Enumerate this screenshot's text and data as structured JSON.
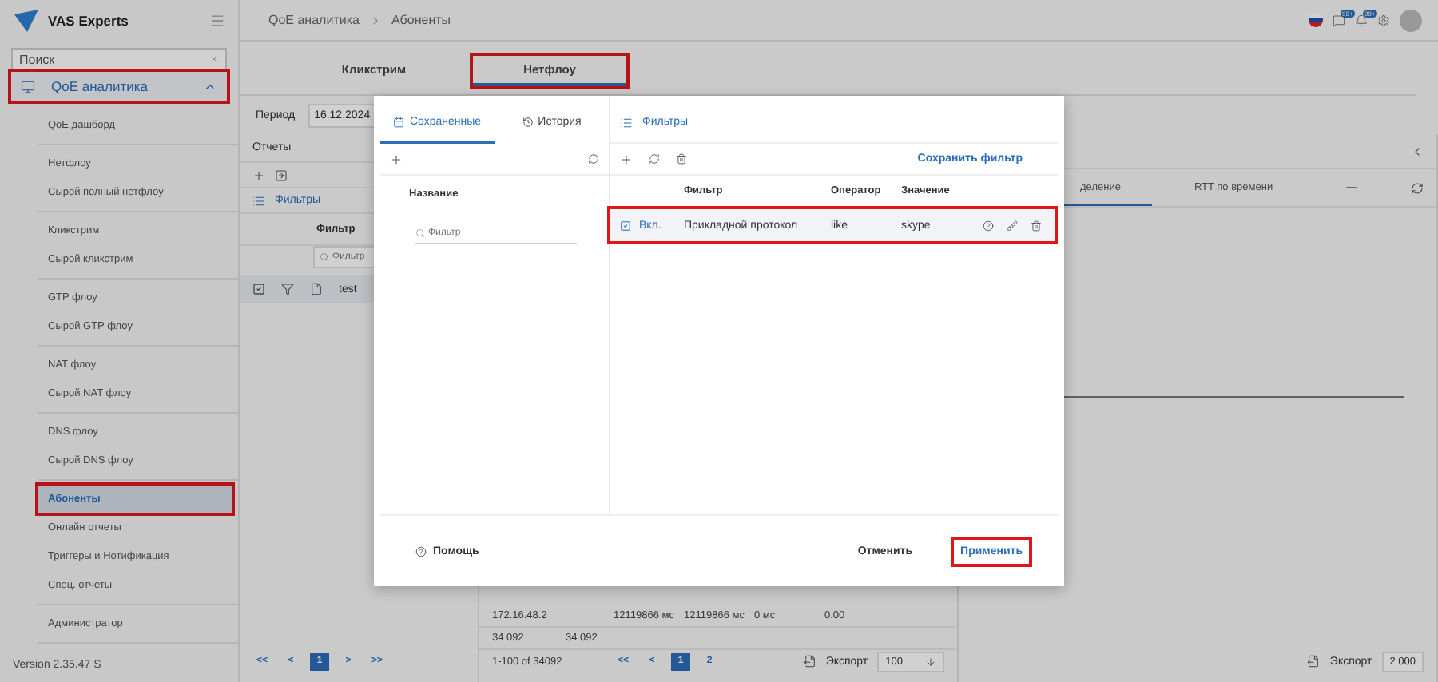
{
  "sidebar": {
    "logo_text": "VAS Experts",
    "search": {
      "placeholder": "Поиск"
    },
    "group": {
      "label": "QoE аналитика",
      "expanded": true,
      "highlighted": true
    },
    "sections": [
      {
        "items": [
          {
            "label": "QoE дашборд",
            "selected": false,
            "highlighted": false
          }
        ]
      },
      {
        "items": [
          {
            "label": "Нетфлоу",
            "selected": false,
            "highlighted": false
          },
          {
            "label": "Сырой полный нетфлоу",
            "selected": false,
            "highlighted": false
          }
        ]
      },
      {
        "items": [
          {
            "label": "Кликстрим",
            "selected": false,
            "highlighted": false
          },
          {
            "label": "Сырой кликстрим",
            "selected": false,
            "highlighted": false
          }
        ]
      },
      {
        "items": [
          {
            "label": "GTP флоу",
            "selected": false,
            "highlighted": false
          },
          {
            "label": "Сырой GTP флоу",
            "selected": false,
            "highlighted": false
          }
        ]
      },
      {
        "items": [
          {
            "label": "NAT флоу",
            "selected": false,
            "highlighted": false
          },
          {
            "label": "Сырой NAT флоу",
            "selected": false,
            "highlighted": false
          }
        ]
      },
      {
        "items": [
          {
            "label": "DNS флоу",
            "selected": false,
            "highlighted": false
          },
          {
            "label": "Сырой DNS флоу",
            "selected": false,
            "highlighted": false
          }
        ]
      },
      {
        "items": [
          {
            "label": "Абоненты",
            "selected": true,
            "highlighted": true
          },
          {
            "label": "Онлайн отчеты",
            "selected": false,
            "highlighted": false
          },
          {
            "label": "Триггеры и Нотификация",
            "selected": false,
            "highlighted": false
          },
          {
            "label": "Спец. отчеты",
            "selected": false,
            "highlighted": false
          }
        ]
      },
      {
        "items": [
          {
            "label": "Администратор",
            "selected": false,
            "highlighted": false
          }
        ]
      }
    ],
    "version": "Version 2.35.47 S"
  },
  "header": {
    "breadcrumb": [
      "QoE аналитика",
      "Абоненты"
    ],
    "badges": [
      "99+",
      "99+"
    ]
  },
  "tabs": [
    {
      "label": "Кликстрим",
      "selected": false,
      "highlighted": false
    },
    {
      "label": "Нетфлоу",
      "selected": true,
      "highlighted": true
    }
  ],
  "period": {
    "label": "Период",
    "value": "16.12.2024"
  },
  "reports": {
    "title": "Отчеты",
    "filters_label": "Фильтры",
    "column": "Фильтр",
    "filter_placeholder": "Фильтр",
    "rows": [
      {
        "name": "test",
        "checked": true
      }
    ],
    "pages": [
      {
        "label": "<<",
        "selected": false
      },
      {
        "label": "<",
        "selected": false
      },
      {
        "label": "1",
        "selected": true
      },
      {
        "label": ">",
        "selected": false
      },
      {
        "label": ">>",
        "selected": false
      }
    ]
  },
  "table": {
    "row": [
      "172.16.48.2",
      "12119866 мс",
      "12119866 мс",
      "0 мс",
      "0.00"
    ],
    "totals": [
      "34 092",
      "34 092"
    ],
    "range": "1-100 of 34092",
    "pages": [
      {
        "label": "<<",
        "selected": false
      },
      {
        "label": "<",
        "selected": false
      },
      {
        "label": "1",
        "selected": true
      },
      {
        "label": "2",
        "selected": false
      }
    ],
    "export": "Экспорт",
    "page_size": "100"
  },
  "chart_panel": {
    "tabs": [
      {
        "label": "деление",
        "selected": true
      },
      {
        "label": "RTT по времени",
        "selected": false
      },
      {
        "label": "—",
        "selected": false
      }
    ],
    "export": "Экспорт",
    "limit": "2 000"
  },
  "modal": {
    "tabs": [
      {
        "label": "Сохраненные",
        "selected": true
      },
      {
        "label": "История",
        "selected": false
      }
    ],
    "name_column": "Название",
    "name_placeholder": "Фильтр",
    "filters_title": "Фильтры",
    "save_label": "Сохранить фильтр",
    "columns": [
      "Фильтр",
      "Оператор",
      "Значение"
    ],
    "rows": [
      {
        "checked": true,
        "state": "Вкл.",
        "filter": "Прикладной протокол",
        "operator": "like",
        "value": "skype",
        "highlighted": true
      }
    ],
    "help": "Помощь",
    "cancel": "Отменить",
    "apply": {
      "label": "Применить",
      "highlighted": true
    }
  }
}
